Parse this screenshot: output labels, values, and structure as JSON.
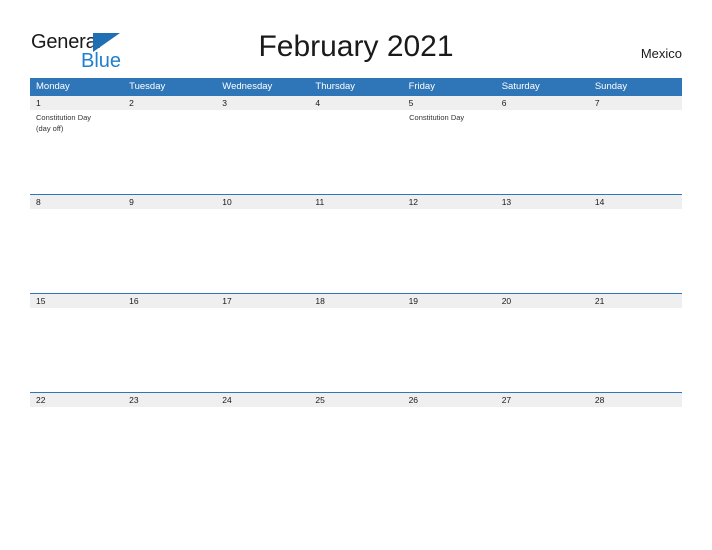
{
  "brand": {
    "name_part1": "General",
    "name_part2": "Blue",
    "triangle_icon": "triangle-icon"
  },
  "header": {
    "title": "February 2021",
    "country": "Mexico"
  },
  "calendar": {
    "month": "February",
    "year": "2021",
    "week_start": "Monday",
    "weekday_headers": [
      "Monday",
      "Tuesday",
      "Wednesday",
      "Thursday",
      "Friday",
      "Saturday",
      "Sunday"
    ],
    "colors": {
      "header_blue": "#2f76b8",
      "number_band": "#efefef",
      "rule_blue": "#2f76b8",
      "logo_blue": "#1f7fd0",
      "text": "#1a1a1a"
    },
    "weeks": [
      {
        "numbers": [
          "1",
          "2",
          "3",
          "4",
          "5",
          "6",
          "7"
        ],
        "events": [
          "Constitution Day\n(day off)",
          "",
          "",
          "",
          "Constitution Day",
          "",
          ""
        ]
      },
      {
        "numbers": [
          "8",
          "9",
          "10",
          "11",
          "12",
          "13",
          "14"
        ],
        "events": [
          "",
          "",
          "",
          "",
          "",
          "",
          ""
        ]
      },
      {
        "numbers": [
          "15",
          "16",
          "17",
          "18",
          "19",
          "20",
          "21"
        ],
        "events": [
          "",
          "",
          "",
          "",
          "",
          "",
          ""
        ]
      },
      {
        "numbers": [
          "22",
          "23",
          "24",
          "25",
          "26",
          "27",
          "28"
        ],
        "events": [
          "",
          "",
          "",
          "",
          "",
          "",
          ""
        ]
      }
    ]
  }
}
